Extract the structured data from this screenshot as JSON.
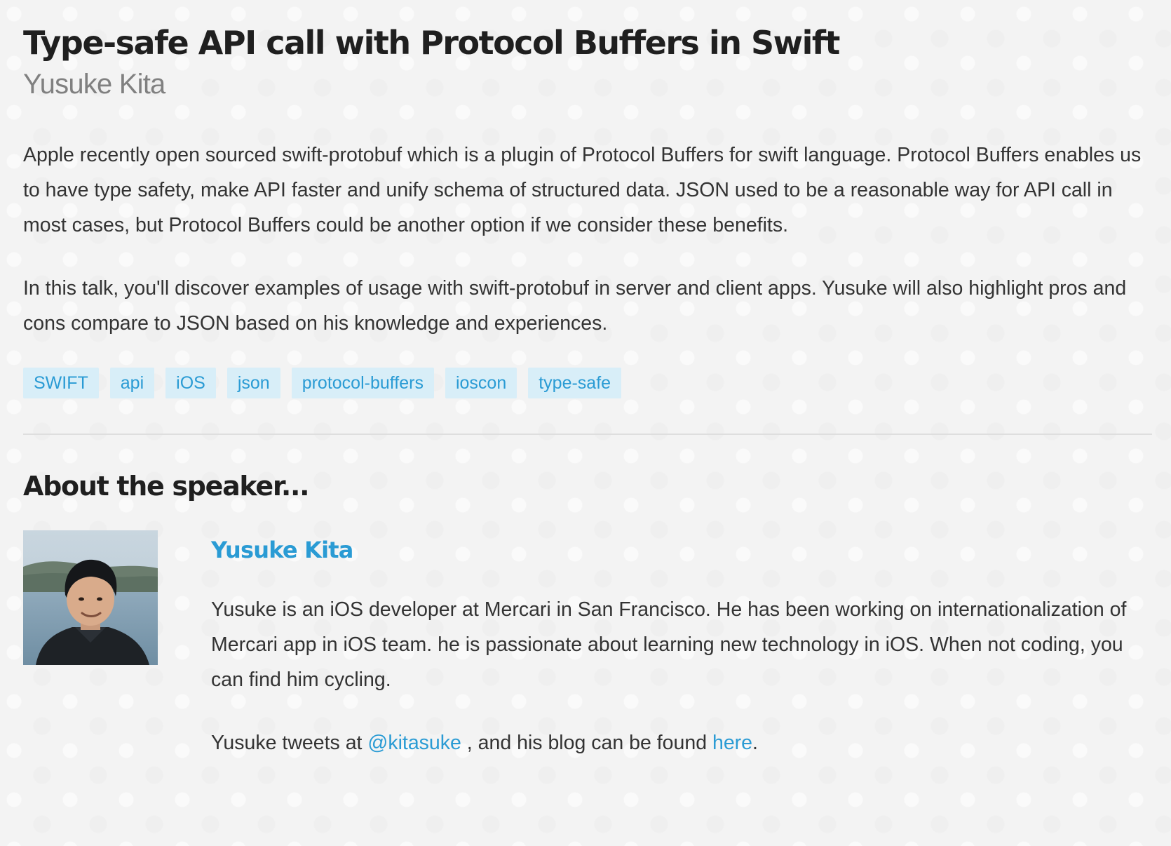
{
  "talk": {
    "title": "Type-safe API call with Protocol Buffers in Swift",
    "speaker": "Yusuke Kita",
    "abstract": [
      "Apple recently open sourced swift-protobuf which is a plugin of Protocol Buffers for swift language. Protocol Buffers enables us to have type safety, make API faster and unify schema of structured data. JSON used to be a reasonable way for API call in most cases, but Protocol Buffers could be another option if we consider these benefits.",
      "In this talk, you'll discover examples of usage with swift-protobuf in server and client apps. Yusuke will also highlight pros and cons compare to JSON based on his knowledge and experiences."
    ],
    "tags": [
      "SWIFT",
      "api",
      "iOS",
      "json",
      "protocol-buffers",
      "ioscon",
      "type-safe"
    ]
  },
  "about": {
    "heading": "About the speaker...",
    "name": "Yusuke Kita",
    "bio": "Yusuke is an iOS developer at Mercari in San Francisco. He has been working on internationalization of Mercari app in iOS team. he is passionate about learning new technology in iOS. When not coding, you can find him cycling.",
    "tweets_prefix": "Yusuke tweets at ",
    "twitter_handle": "@kitasuke",
    "tweets_middle": " , and his blog can be found ",
    "blog_link": "here",
    "tweets_suffix": "."
  },
  "colors": {
    "accent": "#2a9bd4",
    "tag_bg": "#d8eef8",
    "text": "#333333",
    "muted": "#808080"
  }
}
